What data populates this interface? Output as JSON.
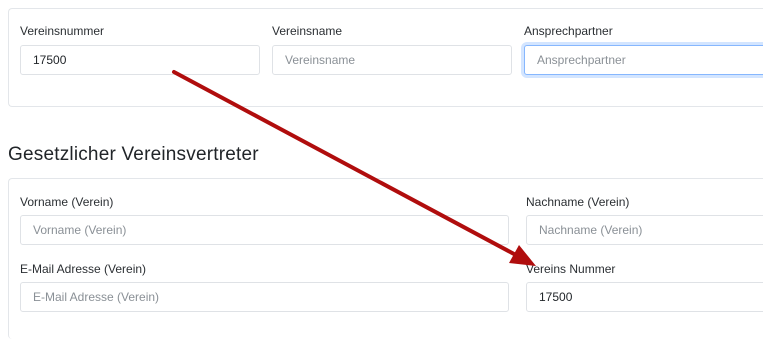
{
  "club": {
    "number_label": "Vereinsnummer",
    "number_value": "17500",
    "name_label": "Vereinsname",
    "name_placeholder": "Vereinsname",
    "contact_label": "Ansprechpartner",
    "contact_placeholder": "Ansprechpartner"
  },
  "representative": {
    "section_title": "Gesetzlicher Vereinsvertreter",
    "firstname_label": "Vorname (Verein)",
    "firstname_placeholder": "Vorname (Verein)",
    "lastname_label": "Nachname (Verein)",
    "lastname_placeholder": "Nachname (Verein)",
    "email_label": "E-Mail Adresse (Verein)",
    "email_placeholder": "E-Mail Adresse (Verein)",
    "club_number_label": "Vereins Nummer",
    "club_number_value": "17500"
  },
  "colors": {
    "annotation_arrow": "#b00d0d",
    "focus_border": "#86b7fe"
  }
}
